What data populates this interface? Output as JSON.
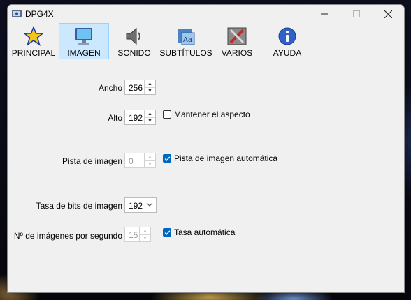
{
  "window": {
    "title": "DPG4X"
  },
  "toolbar": {
    "items": [
      {
        "label": "PRINCIPAL",
        "icon": "star-icon",
        "active": false
      },
      {
        "label": "IMAGEN",
        "icon": "monitor-icon",
        "active": true
      },
      {
        "label": "SONIDO",
        "icon": "speaker-icon",
        "active": false
      },
      {
        "label": "SUBTÍTULOS",
        "icon": "subtitles-icon",
        "active": false
      },
      {
        "label": "VARIOS",
        "icon": "tools-icon",
        "active": false
      },
      {
        "label": "AYUDA",
        "icon": "info-icon",
        "active": false
      }
    ]
  },
  "form": {
    "width": {
      "label": "Ancho",
      "value": "256"
    },
    "height": {
      "label": "Alto",
      "value": "192"
    },
    "keep_aspect": {
      "label": "Mantener el aspecto",
      "checked": false
    },
    "video_track": {
      "label": "Pista de imagen",
      "value": "0",
      "enabled": false
    },
    "auto_track": {
      "label": "Pista de imagen automática",
      "checked": true
    },
    "bitrate": {
      "label": "Tasa de bits de imagen",
      "value": "192"
    },
    "fps": {
      "label": "Nº de imágenes por segundo",
      "value": "15",
      "enabled": false
    },
    "auto_rate": {
      "label": "Tasa automática",
      "checked": true
    }
  },
  "colors": {
    "accent": "#0067c0",
    "active_tab_bg": "#cce8ff"
  }
}
